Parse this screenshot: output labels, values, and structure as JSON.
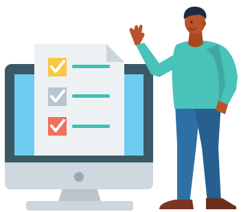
{
  "illustration": {
    "checklist": {
      "items": [
        {
          "icon": "check-mark-icon",
          "box_color": "#f9c744",
          "line_color": "#3fc1b1"
        },
        {
          "icon": "check-mark-icon",
          "box_color": "#b7c5d1",
          "line_color": "#3fc1b1"
        },
        {
          "icon": "check-mark-icon",
          "box_color": "#f26f5c",
          "line_color": "#3fc1b1"
        }
      ]
    },
    "palette": {
      "monitor_frame": "#3a5965",
      "monitor_screen": "#6ecbf0",
      "monitor_bezel": "#cfd8df",
      "stand": "#b9c4cc",
      "paper": "#eef1f4",
      "shirt": "#49c2b9",
      "pants": "#2e6fa6",
      "skin": "#b8532b",
      "hair": "#1f2a44",
      "shoes": "#7a3623"
    }
  }
}
